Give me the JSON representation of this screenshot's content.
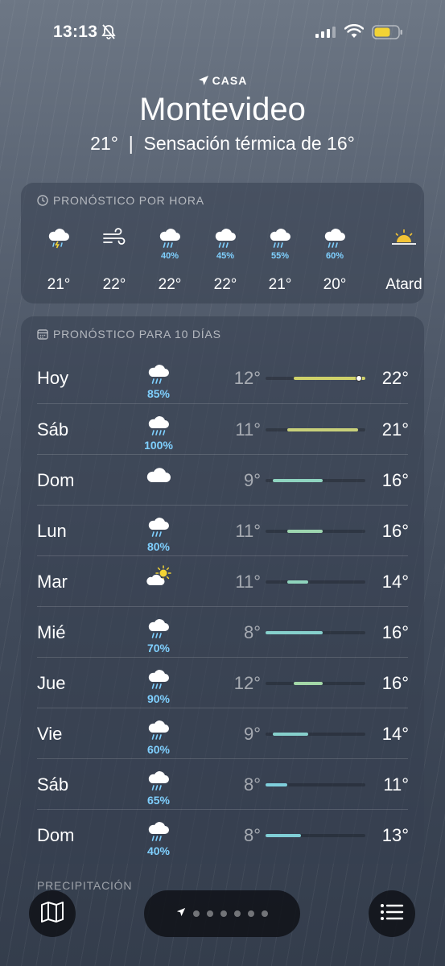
{
  "status_bar": {
    "time": "13:13"
  },
  "header": {
    "location_label": "CASA",
    "city": "Montevideo",
    "current_temp": "21°",
    "separator": "|",
    "feels_like": "Sensación térmica de 16°"
  },
  "hourly": {
    "title": "PRONÓSTICO POR HORA",
    "items": [
      {
        "icon": "thunderstorm-icon",
        "pct": "",
        "temp": "21°"
      },
      {
        "icon": "wind-icon",
        "pct": "",
        "temp": "22°"
      },
      {
        "icon": "rain-icon",
        "pct": "40%",
        "temp": "22°"
      },
      {
        "icon": "rain-icon",
        "pct": "45%",
        "temp": "22°"
      },
      {
        "icon": "rain-icon",
        "pct": "55%",
        "temp": "21°"
      },
      {
        "icon": "rain-icon",
        "pct": "60%",
        "temp": "20°"
      },
      {
        "icon": "sunset-icon",
        "pct": "",
        "temp": "Atard"
      }
    ]
  },
  "daily": {
    "title": "PRONÓSTICO PARA 10 DÍAS",
    "scale": {
      "min": 8,
      "max": 22
    },
    "current_temp_value": 21,
    "days": [
      {
        "name": "Hoy",
        "icon": "rain-icon",
        "pct": "85%",
        "low": "12°",
        "high": "22°",
        "low_val": 12,
        "high_val": 22,
        "color": "#cfd26a"
      },
      {
        "name": "Sáb",
        "icon": "heavy-rain-icon",
        "pct": "100%",
        "low": "11°",
        "high": "21°",
        "low_val": 11,
        "high_val": 21,
        "color": "#c8d07a"
      },
      {
        "name": "Dom",
        "icon": "cloud-icon",
        "pct": "",
        "low": "9°",
        "high": "16°",
        "low_val": 9,
        "high_val": 16,
        "color": "#8fd4c0"
      },
      {
        "name": "Lun",
        "icon": "rain-icon",
        "pct": "80%",
        "low": "11°",
        "high": "16°",
        "low_val": 11,
        "high_val": 16,
        "color": "#9ed6b0"
      },
      {
        "name": "Mar",
        "icon": "partly-sunny-icon",
        "pct": "",
        "low": "11°",
        "high": "14°",
        "low_val": 11,
        "high_val": 14,
        "color": "#8fd4bd"
      },
      {
        "name": "Mié",
        "icon": "rain-icon",
        "pct": "70%",
        "low": "8°",
        "high": "16°",
        "low_val": 8,
        "high_val": 16,
        "color": "#86d0cc"
      },
      {
        "name": "Jue",
        "icon": "rain-icon",
        "pct": "90%",
        "low": "12°",
        "high": "16°",
        "low_val": 12,
        "high_val": 16,
        "color": "#a4d8a8"
      },
      {
        "name": "Vie",
        "icon": "rain-icon",
        "pct": "60%",
        "low": "9°",
        "high": "14°",
        "low_val": 9,
        "high_val": 14,
        "color": "#86d0cc"
      },
      {
        "name": "Sáb",
        "icon": "rain-icon",
        "pct": "65%",
        "low": "8°",
        "high": "11°",
        "low_val": 8,
        "high_val": 11,
        "color": "#7fcfdc"
      },
      {
        "name": "Dom",
        "icon": "rain-icon",
        "pct": "40%",
        "low": "8°",
        "high": "13°",
        "low_val": 8,
        "high_val": 13,
        "color": "#80cfd6"
      }
    ]
  },
  "next_section": {
    "title": "PRECIPITACIÓN"
  },
  "bottom_bar": {
    "map_icon": "map-icon",
    "list_icon": "list-icon",
    "page_dots": 6
  }
}
